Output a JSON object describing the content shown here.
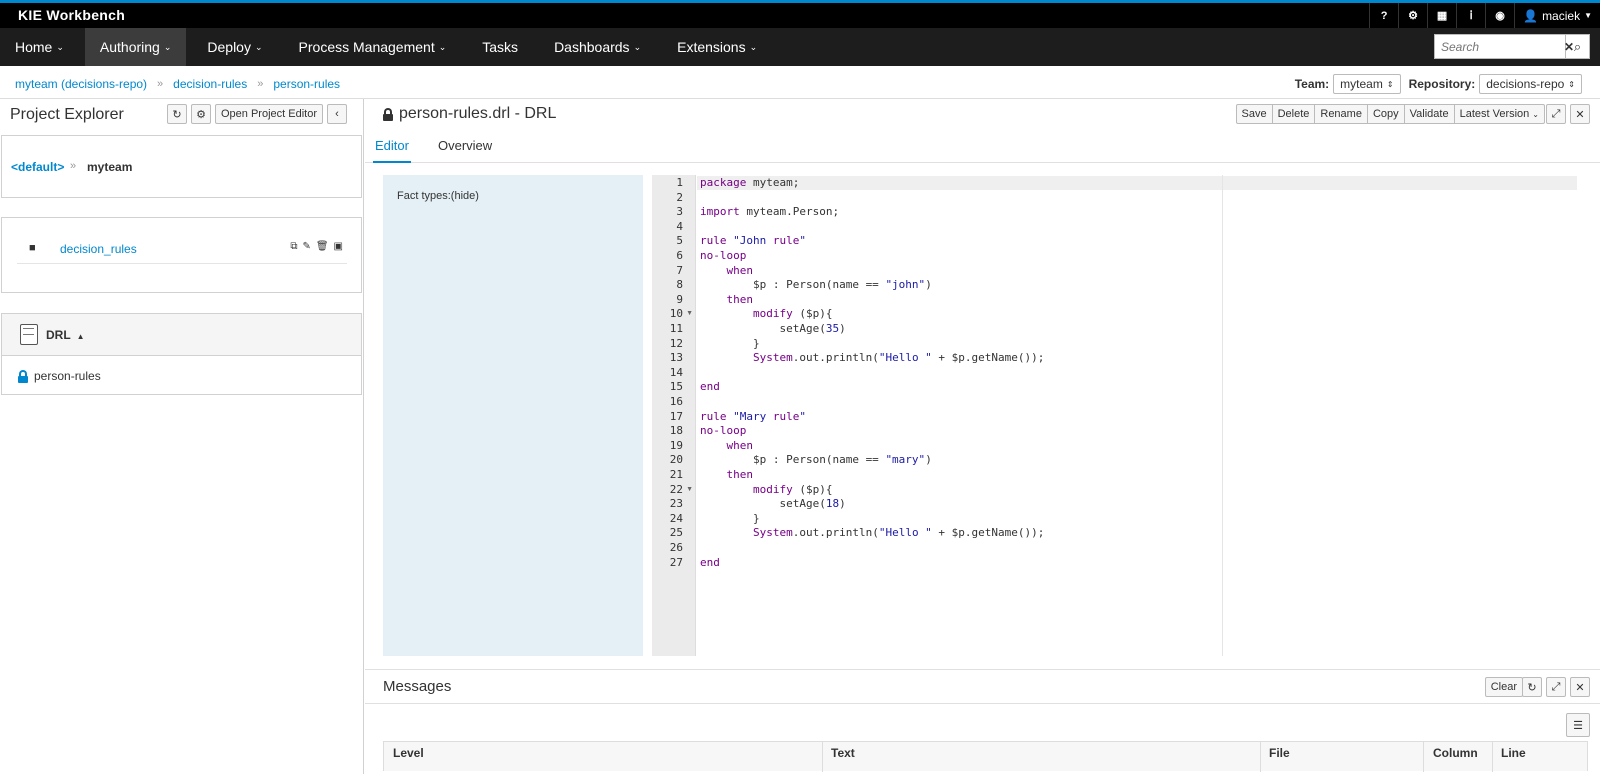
{
  "app": {
    "title": "KIE Workbench"
  },
  "utility": {
    "help": "?",
    "settings": "⚙",
    "apps": "▦",
    "info": "ⅰ",
    "camera": "◉",
    "user": "maciek"
  },
  "nav": {
    "items": [
      {
        "label": "Home",
        "dropdown": true
      },
      {
        "label": "Authoring",
        "dropdown": true,
        "active": true
      },
      {
        "label": "Deploy",
        "dropdown": true
      },
      {
        "label": "Process Management",
        "dropdown": true
      },
      {
        "label": "Tasks",
        "dropdown": false
      },
      {
        "label": "Dashboards",
        "dropdown": true
      },
      {
        "label": "Extensions",
        "dropdown": true
      }
    ],
    "search_placeholder": "Search"
  },
  "breadcrumb": [
    "myteam (decisions-repo)",
    "decision-rules",
    "person-rules"
  ],
  "context": {
    "team_label": "Team:",
    "team": "myteam",
    "repo_label": "Repository:",
    "repo": "decisions-repo"
  },
  "explorer": {
    "title": "Project Explorer",
    "open_editor": "Open Project Editor",
    "default": "<default>",
    "team": "myteam",
    "folder": "decision_rules",
    "section": "DRL",
    "file": "person-rules"
  },
  "file": {
    "title": "person-rules.drl - DRL"
  },
  "toolbar": {
    "save": "Save",
    "delete": "Delete",
    "rename": "Rename",
    "copy": "Copy",
    "validate": "Validate",
    "version": "Latest Version"
  },
  "tabs": {
    "editor": "Editor",
    "overview": "Overview"
  },
  "facts": {
    "label": "Fact types:(hide)"
  },
  "code": [
    "package myteam;",
    "",
    "import myteam.Person;",
    "",
    "rule \"John rule\"",
    "no-loop",
    "    when",
    "        $p : Person(name == \"john\")",
    "    then",
    "        modify ($p){",
    "            setAge(35)",
    "        }",
    "        System.out.println(\"Hello \" + $p.getName());",
    "",
    "end",
    "",
    "rule \"Mary rule\"",
    "no-loop",
    "    when",
    "        $p : Person(name == \"mary\")",
    "    then",
    "        modify ($p){",
    "            setAge(18)",
    "        }",
    "        System.out.println(\"Hello \" + $p.getName());",
    "",
    "end"
  ],
  "messages": {
    "title": "Messages",
    "clear": "Clear",
    "columns": [
      "Level",
      "Text",
      "File",
      "Column",
      "Line"
    ]
  }
}
